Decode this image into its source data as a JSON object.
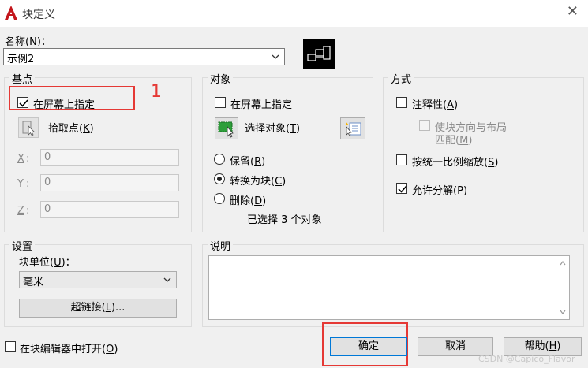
{
  "window": {
    "title": "块定义"
  },
  "name": {
    "label": "名称",
    "hotkey": "N",
    "colon": "：",
    "value": "示例2"
  },
  "basepoint": {
    "title": "基点",
    "specify_label": "在屏幕上指定",
    "specify_checked": true,
    "pick_label": "拾取点",
    "pick_hotkey": "K",
    "x_label": "X",
    "x_value": "0",
    "y_label": "Y",
    "y_value": "0",
    "z_label": "Z",
    "z_value": "0",
    "annotation_number": "1"
  },
  "objects": {
    "title": "对象",
    "specify_label": "在屏幕上指定",
    "select_label": "选择对象",
    "select_hotkey": "T",
    "retain_label": "保留",
    "retain_hotkey": "R",
    "convert_label": "转换为块",
    "convert_hotkey": "C",
    "delete_label": "删除",
    "delete_hotkey": "D",
    "selected_status": "已选择 3 个对象"
  },
  "behavior": {
    "title": "方式",
    "annotative_label": "注释性",
    "annotative_hotkey": "A",
    "match_line1": "使块方向与布局",
    "match_line2": "匹配",
    "match_hotkey": "M",
    "uniform_label": "按统一比例缩放",
    "uniform_hotkey": "S",
    "explode_label": "允许分解",
    "explode_hotkey": "P",
    "explode_checked": true
  },
  "settings": {
    "title": "设置",
    "unit_label": "块单位",
    "unit_hotkey": "U",
    "unit_value": "毫米",
    "hyperlink_label": "超链接",
    "hyperlink_hotkey": "L"
  },
  "description": {
    "title": "说明",
    "value": ""
  },
  "footer": {
    "open_in_editor_label": "在块编辑器中打开",
    "open_in_editor_hotkey": "O",
    "ok_label": "确定",
    "cancel_label": "取消",
    "help_label": "帮助",
    "help_hotkey": "H"
  },
  "watermark": "CSDN @Capico_Flavor",
  "colors": {
    "annotation_red": "#e53935",
    "app_red": "#c4161c",
    "primary_border": "#0078d7"
  },
  "icons": [
    "autocad-logo-icon",
    "close-icon",
    "pick-point-icon",
    "select-objects-icon",
    "quick-select-icon",
    "block-preview-icon",
    "chevron-down-icon",
    "scroll-up-icon",
    "scroll-down-icon"
  ]
}
